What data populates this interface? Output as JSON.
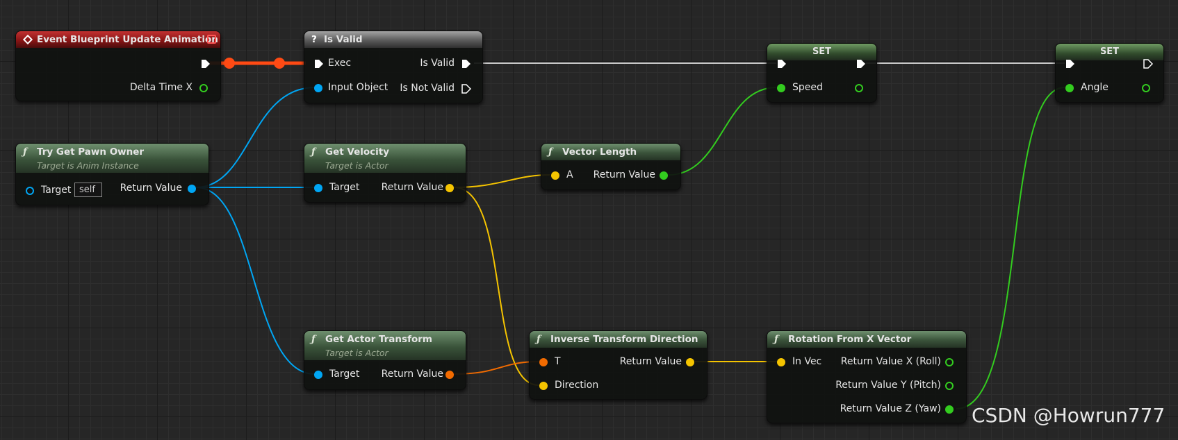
{
  "colors": {
    "exec": "#ffffff",
    "object": "#00a6f4",
    "vector": "#f5c400",
    "float": "#33cc1f",
    "transform": "#f26b00",
    "rotator": "#33cc1f",
    "exec_highlight": "#ff4a14"
  },
  "nodes": {
    "event": {
      "title": "Event Blueprint Update Animation",
      "icon": "event-diamond-icon",
      "pin_delta": "Delta Time X"
    },
    "is_valid": {
      "title": "Is Valid",
      "icon": "question-mark-icon",
      "pin_exec": "Exec",
      "pin_input": "Input Object",
      "pin_valid": "Is Valid",
      "pin_not_valid": "Is Not Valid"
    },
    "try_get_pawn": {
      "title": "Try Get Pawn Owner",
      "subtitle": "Target is Anim Instance",
      "pin_target": "Target",
      "target_value": "self",
      "pin_return": "Return Value"
    },
    "get_velocity": {
      "title": "Get Velocity",
      "subtitle": "Target is Actor",
      "pin_target": "Target",
      "pin_return": "Return Value"
    },
    "vector_length": {
      "title": "Vector Length",
      "pin_a": "A",
      "pin_return": "Return Value"
    },
    "set_speed": {
      "title": "SET",
      "pin_var": "Speed"
    },
    "set_angle": {
      "title": "SET",
      "pin_var": "Angle"
    },
    "get_actor_transform": {
      "title": "Get Actor Transform",
      "subtitle": "Target is Actor",
      "pin_target": "Target",
      "pin_return": "Return Value"
    },
    "inverse_transform": {
      "title": "Inverse Transform Direction",
      "pin_t": "T",
      "pin_direction": "Direction",
      "pin_return": "Return Value"
    },
    "rotation_from_x": {
      "title": "Rotation From X Vector",
      "pin_in": "In Vec",
      "pin_x": "Return Value X (Roll)",
      "pin_y": "Return Value Y (Pitch)",
      "pin_z": "Return Value Z (Yaw)"
    }
  },
  "function_glyph": "ƒ",
  "watermark": "CSDN @Howrun777"
}
